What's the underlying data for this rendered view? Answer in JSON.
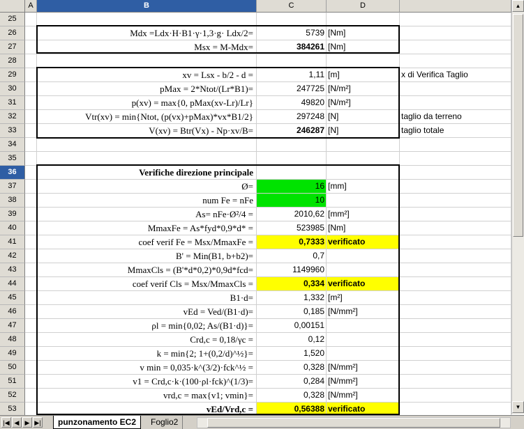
{
  "columns": [
    "A",
    "B",
    "C",
    "D"
  ],
  "active_column": "B",
  "active_row": "36",
  "rows": [
    {
      "n": "25",
      "f": "",
      "v": "",
      "u": "",
      "note": ""
    },
    {
      "n": "26",
      "f": "Mdx =Ldx·H·B1·γ·1,3·g· Ldx/2=",
      "v": "5739",
      "u": "[Nm]",
      "note": ""
    },
    {
      "n": "27",
      "f": "Msx = M-Mdx=",
      "v": "384261",
      "u": "[Nm]",
      "note": "",
      "bold": true
    },
    {
      "n": "28",
      "f": "",
      "v": "",
      "u": "",
      "note": ""
    },
    {
      "n": "29",
      "f": "xv = Lsx - b/2 - d =",
      "v": "1,11",
      "u": "[m]",
      "note": "x di Verifica Taglio"
    },
    {
      "n": "30",
      "f": "pMax = 2*Ntot/(Lr*B1)=",
      "v": "247725",
      "u": "[N/m²]",
      "note": ""
    },
    {
      "n": "31",
      "f": "p(xv) = max{0, pMax(xv-Lr)/Lr}",
      "v": "49820",
      "u": "[N/m²]",
      "note": ""
    },
    {
      "n": "32",
      "f": "Vtr(xv) = min{Ntot, (p(vx)+pMax)*vx*B1/2}",
      "v": "297248",
      "u": "[N]",
      "note": "taglio da terreno"
    },
    {
      "n": "33",
      "f": "V(xv) = Btr(Vx) - Np·xv/B=",
      "v": "246287",
      "u": "[N]",
      "note": "taglio totale",
      "bold": true
    },
    {
      "n": "34",
      "f": "",
      "v": "",
      "u": "",
      "note": ""
    },
    {
      "n": "35",
      "f": "",
      "v": "",
      "u": "",
      "note": ""
    },
    {
      "n": "36",
      "f": "Verifiche direzione principale",
      "v": "",
      "u": "",
      "note": "",
      "title": true
    },
    {
      "n": "37",
      "f": "Ø=",
      "v": "16",
      "u": "[mm]",
      "note": "",
      "fill": "green"
    },
    {
      "n": "38",
      "f": "num  Fe = nFe",
      "v": "10",
      "u": "",
      "note": "",
      "fill": "green"
    },
    {
      "n": "39",
      "f": "As= nFe·Ø²/4  =",
      "v": "2010,62",
      "u": "[mm²]",
      "note": ""
    },
    {
      "n": "40",
      "f": "MmaxFe = As*fyd*0,9*d* =",
      "v": "523985",
      "u": "[Nm]",
      "note": ""
    },
    {
      "n": "41",
      "f": "coef verif Fe =  Msx/MmaxFe =",
      "v": "0,7333",
      "u": "verificato",
      "note": "",
      "fill": "yellow",
      "bold": true
    },
    {
      "n": "42",
      "f": "B' = Min(B1, b+b2)=",
      "v": "0,7",
      "u": "",
      "note": ""
    },
    {
      "n": "43",
      "f": "MmaxCls = (B'*d*0,2)*0,9d*fcd=",
      "v": "1149960",
      "u": "",
      "note": ""
    },
    {
      "n": "44",
      "f": "coef verif Cls =  Msx/MmaxCls =",
      "v": "0,334",
      "u": "verificato",
      "note": "",
      "fill": "yellow",
      "bold": true
    },
    {
      "n": "45",
      "f": "B1·d=",
      "v": "1,332",
      "u": "[m²]",
      "note": ""
    },
    {
      "n": "46",
      "f": "vEd = Ved/(B1·d)=",
      "v": "0,185",
      "u": "[N/mm²]",
      "note": ""
    },
    {
      "n": "47",
      "f": "ρl = min{0,02; As/(B1·d)}=",
      "v": "0,00151",
      "u": "",
      "note": ""
    },
    {
      "n": "48",
      "f": "Crd,c = 0,18/γc =",
      "v": "0,12",
      "u": "",
      "note": ""
    },
    {
      "n": "49",
      "f": "k = min{2; 1+(0,2/d)^½}=",
      "v": "1,520",
      "u": "",
      "note": ""
    },
    {
      "n": "50",
      "f": "v min = 0,035·k^(3/2)·fck^½ =",
      "v": "0,328",
      "u": "[N/mm²]",
      "note": ""
    },
    {
      "n": "51",
      "f": "v1 = Crd,c·k·(100·ρl·fck)^(1/3)=",
      "v": "0,284",
      "u": "[N/mm²]",
      "note": ""
    },
    {
      "n": "52",
      "f": "vrd,c = max{v1; vmin}=",
      "v": "0,328",
      "u": "[N/mm²]",
      "note": ""
    },
    {
      "n": "53",
      "f": "vEd/Vrd,c =",
      "v": "0,56388",
      "u": "verificato",
      "note": "",
      "fill": "yellow",
      "bold": true,
      "fbold": true
    }
  ],
  "tabs": {
    "active": "punzonamento EC2",
    "other": "Foglio2"
  },
  "colors": {
    "header_bg": "#dfdcd4",
    "active_header": "#2f5ea4",
    "input_fill": "#00e300",
    "result_fill": "#ffff00"
  }
}
